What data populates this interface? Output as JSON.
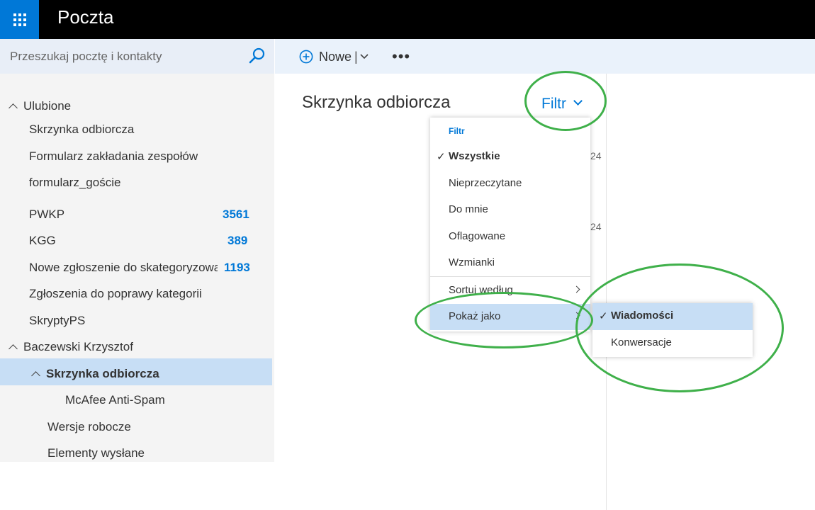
{
  "app": {
    "title": "Poczta"
  },
  "search": {
    "placeholder": "Przeszukaj pocztę i kontakty"
  },
  "commandbar": {
    "new_label": "Nowe",
    "more_label": "•••"
  },
  "sidebar": {
    "favorites_header": "Ulubione",
    "favorites": [
      {
        "label": "Skrzynka odbiorcza"
      },
      {
        "label": "Formularz zakładania zespołów"
      },
      {
        "label": "formularz_goście"
      }
    ],
    "folders": [
      {
        "label": "PWKP",
        "count": "3561"
      },
      {
        "label": "KGG",
        "count": "389"
      },
      {
        "label": "Nowe zgłoszenie do skategoryzowa",
        "count": "1193"
      },
      {
        "label": "Zgłoszenia do poprawy kategorii"
      },
      {
        "label": "SkryptyPS"
      }
    ],
    "account_header": "Baczewski Krzysztof",
    "account_items": [
      {
        "label": "Skrzynka odbiorcza"
      },
      {
        "label": "McAfee Anti-Spam"
      },
      {
        "label": "Wersje robocze"
      },
      {
        "label": "Elementy wysłane"
      }
    ]
  },
  "main": {
    "folder_title": "Skrzynka odbiorcza",
    "filter_label": "Filtr",
    "peek": [
      "24",
      "24"
    ]
  },
  "filter_menu": {
    "header": "Filtr",
    "items": [
      {
        "label": "Wszystkie",
        "checked": true
      },
      {
        "label": "Nieprzeczytane"
      },
      {
        "label": "Do mnie"
      },
      {
        "label": "Oflagowane"
      },
      {
        "label": "Wzmianki"
      }
    ],
    "sort_label": "Sortuj według",
    "show_as_label": "Pokaż jako",
    "check_glyph": "✓"
  },
  "show_as_submenu": {
    "items": [
      {
        "label": "Wiadomości",
        "checked": true
      },
      {
        "label": "Konwersacje"
      }
    ]
  },
  "colors": {
    "accent": "#0078d7",
    "selected": "#c7def5",
    "annotation": "#3fb04a"
  }
}
